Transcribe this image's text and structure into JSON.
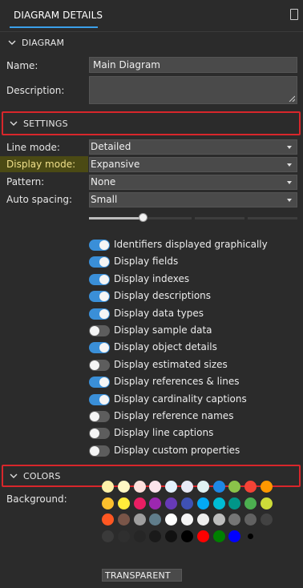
{
  "tab": {
    "label": "DIAGRAM DETAILS"
  },
  "sections": {
    "diagram": "DIAGRAM",
    "settings": "SETTINGS",
    "colors": "COLORS"
  },
  "diagram": {
    "name_label": "Name:",
    "name_value": "Main Diagram",
    "description_label": "Description:",
    "description_value": ""
  },
  "settings": {
    "line_mode_label": "Line mode:",
    "line_mode_value": "Detailed",
    "display_mode_label": "Display mode:",
    "display_mode_value": "Expansive",
    "pattern_label": "Pattern:",
    "pattern_value": "None",
    "auto_spacing_label": "Auto spacing:",
    "auto_spacing_value": "Small",
    "auto_spacing_slider_fraction": 0.26,
    "toggles": [
      {
        "label": "Identifiers displayed graphically",
        "on": true
      },
      {
        "label": "Display fields",
        "on": true
      },
      {
        "label": "Display indexes",
        "on": true
      },
      {
        "label": "Display descriptions",
        "on": true
      },
      {
        "label": "Display data types",
        "on": true
      },
      {
        "label": "Display sample data",
        "on": false
      },
      {
        "label": "Display object details",
        "on": true
      },
      {
        "label": "Display estimated sizes",
        "on": false
      },
      {
        "label": "Display references & lines",
        "on": true
      },
      {
        "label": "Display cardinality captions",
        "on": true
      },
      {
        "label": "Display reference names",
        "on": false
      },
      {
        "label": "Display line captions",
        "on": false
      },
      {
        "label": "Display custom properties",
        "on": false
      }
    ]
  },
  "colors": {
    "background_label": "Background:",
    "transparent_label": "TRANSPARENT",
    "palette": [
      [
        "#fff2a8",
        "#fff8c4",
        "#fde0dc",
        "#fce4ec",
        "#e3f2fd",
        "#e8eaf6",
        "#e0f2f1",
        "#1e88e5",
        "#8bc34a",
        "#f44336",
        "#ff9800"
      ],
      [
        "#fbc02d",
        "#ffeb3b",
        "#e91e63",
        "#9c27b0",
        "#673ab7",
        "#3f51b5",
        "#03a9f4",
        "#00bcd4",
        "#009688",
        "#4caf50",
        "#cddc39"
      ],
      [
        "#ff5722",
        "#795548",
        "#9e9e9e",
        "#607d8b",
        "#ffffff",
        "#f5f5f5",
        "#eeeeee",
        "#bdbdbd",
        "#757575",
        "#616161",
        "#424242"
      ],
      [
        "#3a3a3a",
        "#2f2f2f",
        "#262626",
        "#1a1a1a",
        "#111111",
        "#000000",
        "#ff0000",
        "#008000",
        "#0000ff",
        "#000000"
      ]
    ],
    "accent": "#3a8fd8",
    "highlight": "#d8262b"
  }
}
